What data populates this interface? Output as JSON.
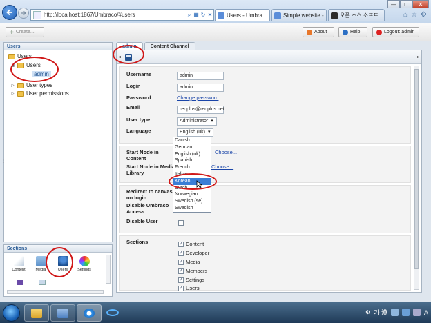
{
  "browser": {
    "url": "http://localhost:1867/Umbraco/#users",
    "tabs": [
      {
        "label": "Users - Umbra...",
        "close": "×",
        "color": "#5b8dd9"
      },
      {
        "label": "Simple website - ...",
        "close": "×",
        "color": "#5b8dd9"
      },
      {
        "label": "오픈 소스 소프트...",
        "close": "×",
        "color": "#2b2b2b"
      }
    ],
    "window_controls": [
      "—",
      "□",
      "✕"
    ],
    "right_icons": [
      "⌂",
      "☆",
      "⚙"
    ]
  },
  "toolbar": {
    "create_label": "Create...",
    "about_label": "About",
    "help_label": "Help",
    "logout_label": "Logout: admin"
  },
  "users_panel": {
    "header": "Users",
    "tree": {
      "root": "Users",
      "folder": "Users",
      "selected": "admin",
      "user_types": "User types",
      "user_permissions": "User permissions"
    }
  },
  "sections_panel": {
    "header": "Sections",
    "items": [
      "Content",
      "Media",
      "Users",
      "Settings"
    ]
  },
  "main": {
    "tabs": [
      "admin",
      "Content Channel"
    ],
    "labels": {
      "username": "Username",
      "login": "Login",
      "password": "Password",
      "email": "Email",
      "user_type": "User type",
      "language": "Language",
      "start_node_content": "Start Node in Content",
      "start_node_media": "Start Node in Media Library",
      "redirect": "Redirect to canvas on login",
      "disable_access": "Disable Umbraco Access",
      "disable_user": "Disable User",
      "sections": "Sections"
    },
    "values": {
      "username": "admin",
      "login": "admin",
      "change_password": "Change password",
      "email": "redplus@redplus.net",
      "user_type": "Administrator",
      "language": "English (uk)",
      "choose": "Choose...",
      "choose_media": "Choose..."
    },
    "sections_checked": [
      "Content",
      "Developer",
      "Media",
      "Members",
      "Settings",
      "Users"
    ],
    "language_options": [
      "Danish",
      "German",
      "English (uk)",
      "Spanish",
      "French",
      "Italian",
      "Korean",
      "Dutch",
      "Norwegian",
      "Swedish (se)",
      "Swedish"
    ],
    "highlighted_language": "Korean"
  },
  "taskbar": {
    "tray_text": "가 漢",
    "ime": "A"
  }
}
